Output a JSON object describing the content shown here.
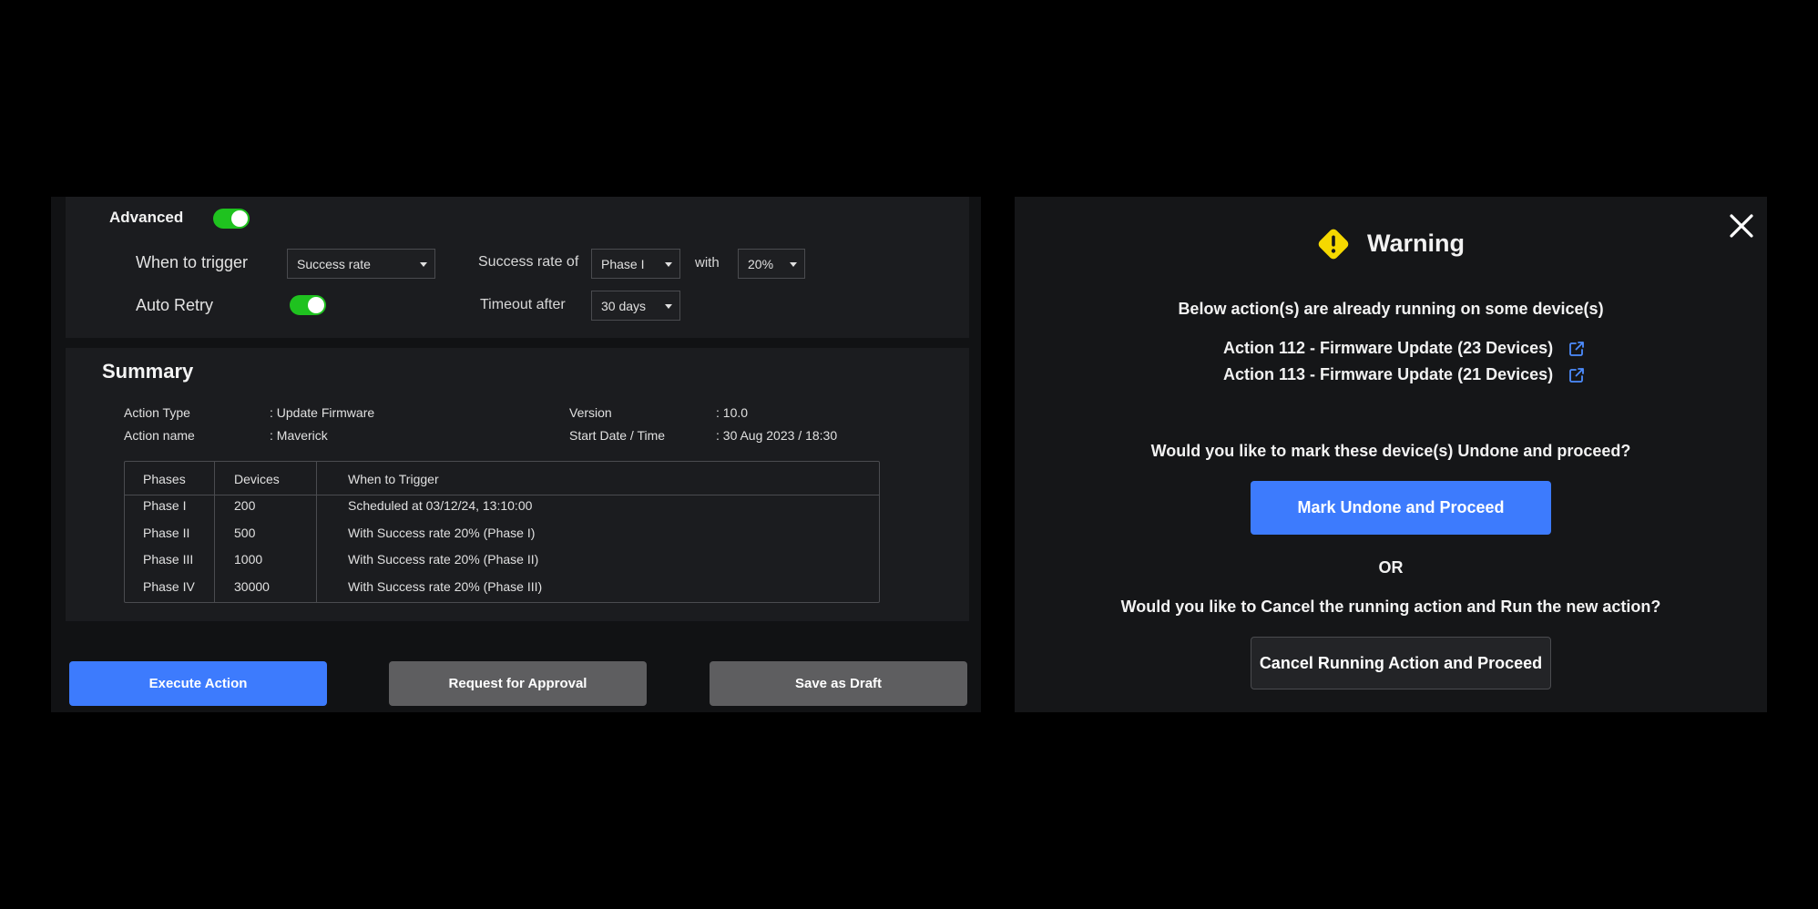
{
  "advanced": {
    "label": "Advanced",
    "enabled": true,
    "when_to_trigger_label": "When to trigger",
    "when_to_trigger_value": "Success rate",
    "success_rate_of_label": "Success rate of",
    "phase_value": "Phase I",
    "with_label": "with",
    "percent_value": "20%",
    "auto_retry_label": "Auto Retry",
    "auto_retry_enabled": true,
    "timeout_label": "Timeout after",
    "timeout_value": "30 days"
  },
  "summary": {
    "title": "Summary",
    "action_type_label": "Action Type",
    "action_type_value": ": Update Firmware",
    "action_name_label": "Action name",
    "action_name_value": ": Maverick",
    "version_label": "Version",
    "version_value": ": 10.0",
    "start_label": "Start Date / Time",
    "start_value": ": 30 Aug 2023 / 18:30",
    "table": {
      "headers": [
        "Phases",
        "Devices",
        "When to Trigger"
      ],
      "rows": [
        [
          "Phase I",
          "200",
          "Scheduled at 03/12/24, 13:10:00"
        ],
        [
          "Phase II",
          "500",
          "With Success rate 20% (Phase I)"
        ],
        [
          "Phase III",
          "1000",
          "With Success rate 20% (Phase II)"
        ],
        [
          "Phase IV",
          "30000",
          "With Success rate 20% (Phase III)"
        ]
      ]
    }
  },
  "actions": {
    "execute": "Execute Action",
    "request": "Request for Approval",
    "draft": "Save as Draft"
  },
  "warning": {
    "title": "Warning",
    "intro": "Below action(s) are already running on some device(s)",
    "running_actions": [
      "Action 112 - Firmware Update (23 Devices)",
      "Action 113 - Firmware Update (21 Devices)"
    ],
    "question_undone": "Would you like to mark these device(s) Undone and proceed?",
    "mark_button": "Mark Undone and Proceed",
    "or": "OR",
    "question_cancel": "Would you like to Cancel the running action and Run the new action?",
    "cancel_button": "Cancel Running Action and Proceed"
  },
  "colors": {
    "primary": "#3d7bfd",
    "toggle_on": "#1fc21f",
    "warning_icon": "#f5d800",
    "link_icon": "#4d8dff"
  }
}
